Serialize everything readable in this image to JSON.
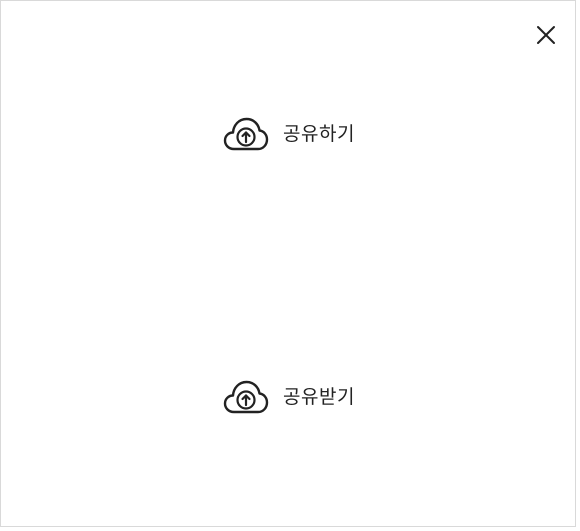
{
  "dialog": {
    "close_icon": "close-icon",
    "actions": [
      {
        "id": "share",
        "label": "공유하기",
        "icon": "cloud-upload-icon"
      },
      {
        "id": "receive",
        "label": "공유받기",
        "icon": "cloud-upload-icon"
      }
    ]
  },
  "colors": {
    "icon": "#222222",
    "text": "#222222",
    "border": "#d9d9d9",
    "background": "#ffffff"
  }
}
